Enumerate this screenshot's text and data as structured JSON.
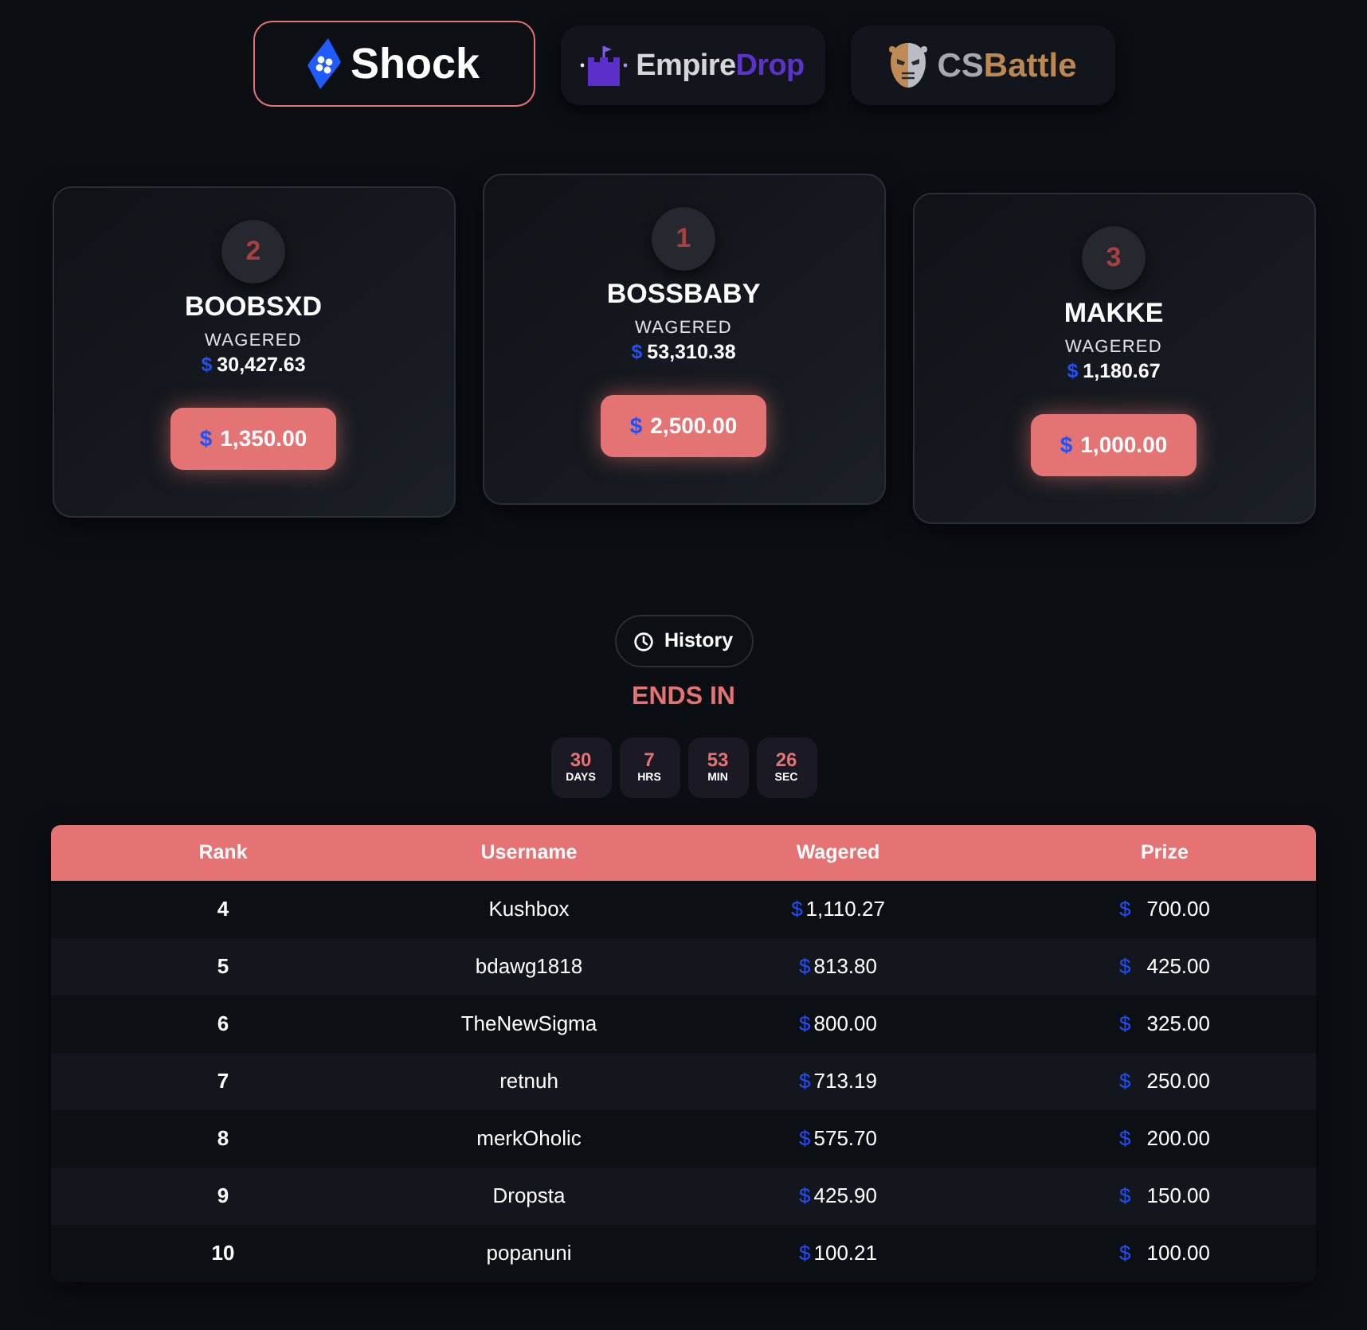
{
  "brand_tabs": [
    {
      "kind": "shock",
      "label_parts": [
        "Shock"
      ],
      "selected": true
    },
    {
      "kind": "empiredrop",
      "label_parts": [
        "Empire",
        "Drop"
      ],
      "selected": false
    },
    {
      "kind": "csbattle",
      "label_parts": [
        "CS",
        "Battle"
      ],
      "selected": false
    }
  ],
  "podium": [
    {
      "rank": "2",
      "username": "BOOBSXD",
      "wagered_label": "WAGERED",
      "wagered": {
        "symbol": "$",
        "amount": "30,427.63"
      },
      "prize": {
        "symbol": "$",
        "amount": "1,350.00"
      }
    },
    {
      "rank": "1",
      "username": "BOSSBABY",
      "wagered_label": "WAGERED",
      "wagered": {
        "symbol": "$",
        "amount": "53,310.38"
      },
      "prize": {
        "symbol": "$",
        "amount": "2,500.00"
      }
    },
    {
      "rank": "3",
      "username": "MAKKE",
      "wagered_label": "WAGERED",
      "wagered": {
        "symbol": "$",
        "amount": "1,180.67"
      },
      "prize": {
        "symbol": "$",
        "amount": "1,000.00"
      }
    }
  ],
  "history_button": {
    "label": "History"
  },
  "countdown": {
    "title": "ENDS IN",
    "units": [
      {
        "value": "30",
        "label": "DAYS"
      },
      {
        "value": "7",
        "label": "HRS"
      },
      {
        "value": "53",
        "label": "MIN"
      },
      {
        "value": "26",
        "label": "SEC"
      }
    ]
  },
  "leaderboard": {
    "columns": [
      "Rank",
      "Username",
      "Wagered",
      "Prize"
    ],
    "rows": [
      {
        "rank": "4",
        "username": "Kushbox",
        "wagered": {
          "symbol": "$",
          "amount": "1,110.27"
        },
        "prize": {
          "symbol": "$",
          "amount": "700.00"
        }
      },
      {
        "rank": "5",
        "username": "bdawg1818",
        "wagered": {
          "symbol": "$",
          "amount": "813.80"
        },
        "prize": {
          "symbol": "$",
          "amount": "425.00"
        }
      },
      {
        "rank": "6",
        "username": "TheNewSigma",
        "wagered": {
          "symbol": "$",
          "amount": "800.00"
        },
        "prize": {
          "symbol": "$",
          "amount": "325.00"
        }
      },
      {
        "rank": "7",
        "username": "retnuh",
        "wagered": {
          "symbol": "$",
          "amount": "713.19"
        },
        "prize": {
          "symbol": "$",
          "amount": "250.00"
        }
      },
      {
        "rank": "8",
        "username": "merkOholic",
        "wagered": {
          "symbol": "$",
          "amount": "575.70"
        },
        "prize": {
          "symbol": "$",
          "amount": "200.00"
        }
      },
      {
        "rank": "9",
        "username": "Dropsta",
        "wagered": {
          "symbol": "$",
          "amount": "425.90"
        },
        "prize": {
          "symbol": "$",
          "amount": "150.00"
        }
      },
      {
        "rank": "10",
        "username": "popanuni",
        "wagered": {
          "symbol": "$",
          "amount": "100.21"
        },
        "prize": {
          "symbol": "$",
          "amount": "100.00"
        }
      }
    ]
  }
}
